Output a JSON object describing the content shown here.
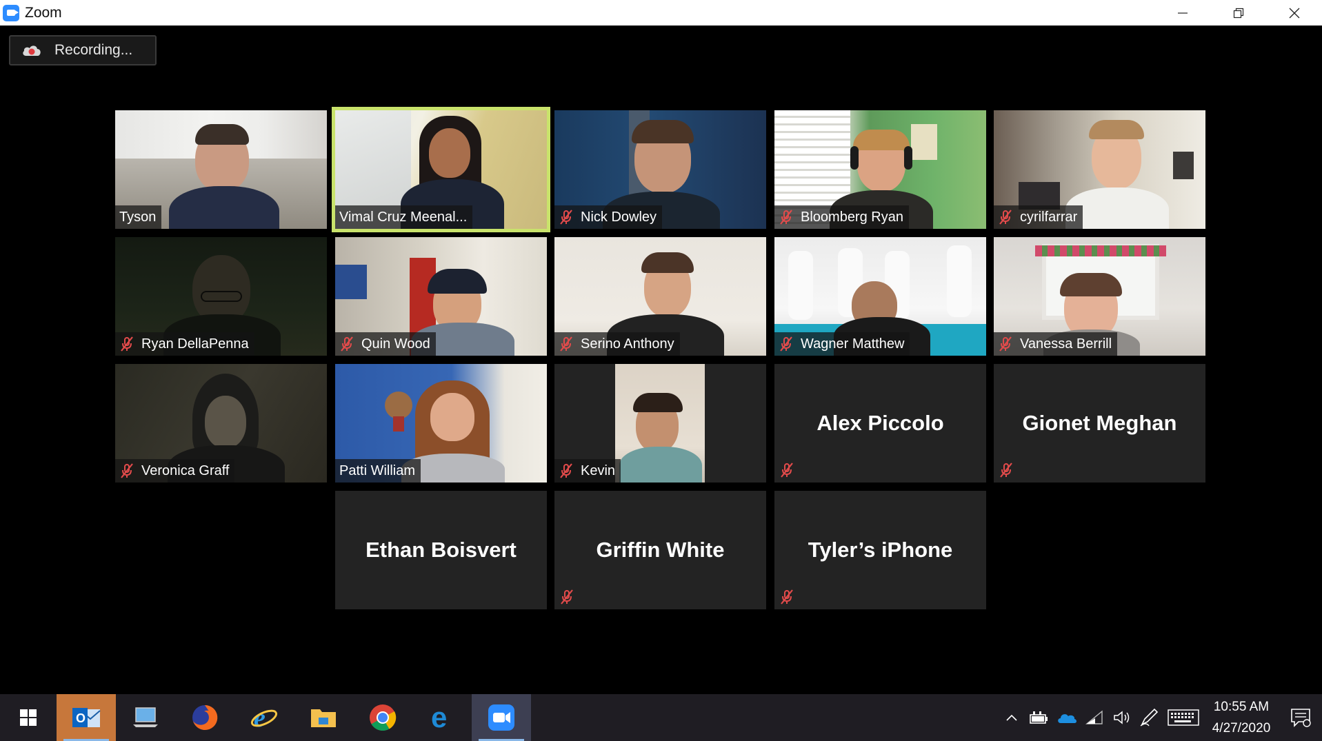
{
  "window": {
    "title": "Zoom"
  },
  "recording": {
    "label": "Recording..."
  },
  "participants": [
    {
      "name": "Tyson",
      "muted": false,
      "video": true
    },
    {
      "name": "Vimal Cruz Meenal...",
      "muted": false,
      "video": true,
      "active_speaker": true
    },
    {
      "name": "Nick Dowley",
      "muted": true,
      "video": true
    },
    {
      "name": "Bloomberg Ryan",
      "muted": true,
      "video": true
    },
    {
      "name": "cyrilfarrar",
      "muted": true,
      "video": true
    },
    {
      "name": "Ryan DellaPenna",
      "muted": true,
      "video": true
    },
    {
      "name": "Quin Wood",
      "muted": true,
      "video": true
    },
    {
      "name": "Serino Anthony",
      "muted": true,
      "video": true
    },
    {
      "name": "Wagner Matthew",
      "muted": true,
      "video": true
    },
    {
      "name": "Vanessa Berrill",
      "muted": true,
      "video": true
    },
    {
      "name": "Veronica Graff",
      "muted": true,
      "video": true
    },
    {
      "name": "Patti William",
      "muted": false,
      "video": true
    },
    {
      "name": "Kevin",
      "muted": true,
      "video": true
    },
    {
      "name": "Alex Piccolo",
      "muted": true,
      "video": false
    },
    {
      "name": "Gionet Meghan",
      "muted": true,
      "video": false
    },
    {
      "name": "Ethan Boisvert",
      "muted": false,
      "video": false
    },
    {
      "name": "Griffin White",
      "muted": true,
      "video": false
    },
    {
      "name": "Tyler’s iPhone",
      "muted": true,
      "video": false
    }
  ],
  "taskbar": {
    "apps": [
      "outlook-icon",
      "this-pc-icon",
      "firefox-icon",
      "internet-explorer-icon",
      "file-explorer-icon",
      "chrome-icon",
      "edge-icon",
      "zoom-icon"
    ],
    "time": "10:55 AM",
    "date": "4/27/2020"
  }
}
